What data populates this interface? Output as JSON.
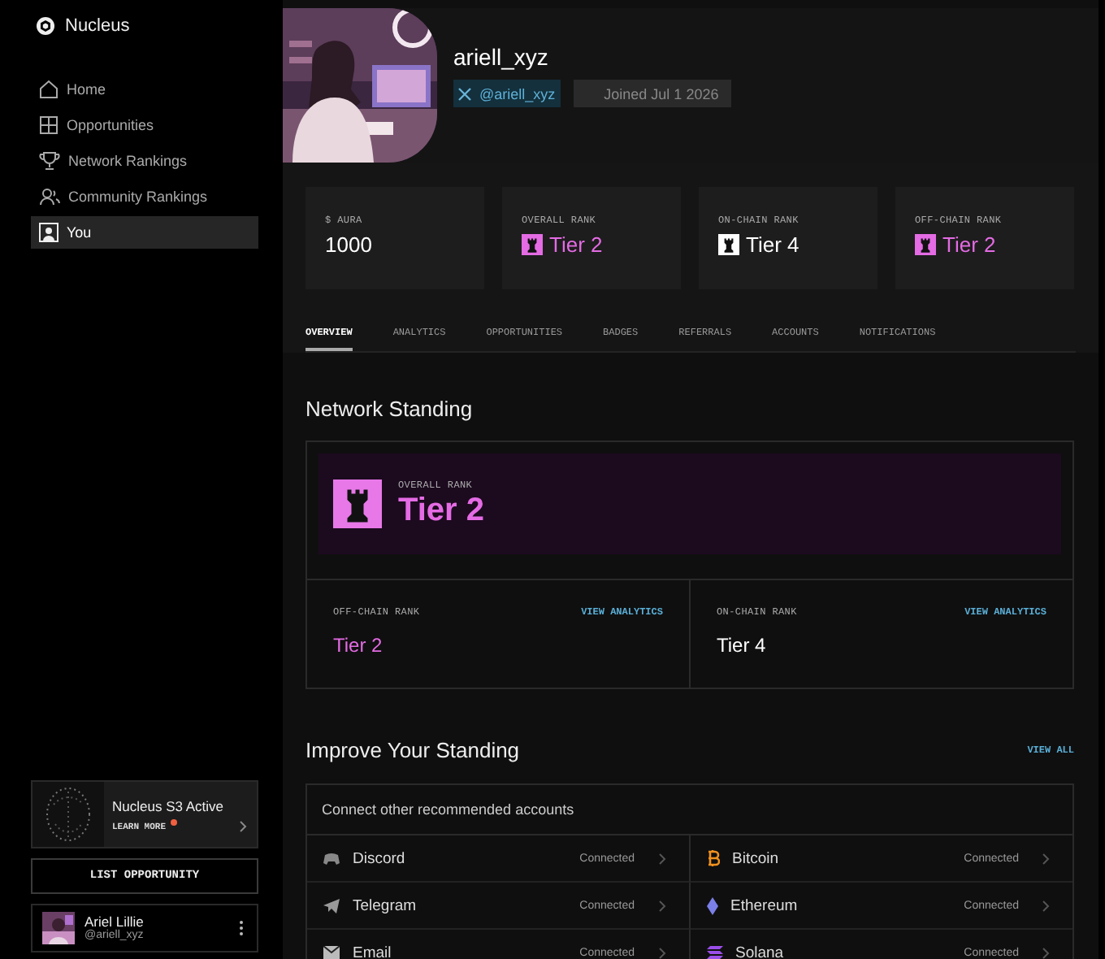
{
  "app": {
    "name": "Nucleus"
  },
  "nav": [
    {
      "label": "Home",
      "kind": "home",
      "selected": false
    },
    {
      "label": "Opportunities",
      "kind": "grid",
      "selected": false
    },
    {
      "label": "Network Rankings",
      "kind": "trophy",
      "selected": false
    },
    {
      "label": "Community Rankings",
      "kind": "people",
      "selected": false
    },
    {
      "label": "You",
      "kind": "user",
      "selected": true
    }
  ],
  "promo": {
    "title": "Nucleus S3 Active",
    "link": "LEARN MORE",
    "unread": true
  },
  "list_button": "LIST OPPORTUNITY",
  "user": {
    "name": "Ariel Lillie",
    "handle": "@ariell_xyz"
  },
  "profile": {
    "username": "ariell_xyz",
    "x_handle": "@ariell_xyz",
    "joined": "Joined Jul 1 2026"
  },
  "stats": [
    {
      "label": "$ AURA",
      "value": "1000",
      "kind": "plain"
    },
    {
      "label": "OVERALL RANK",
      "value": "Tier 2",
      "kind": "rank",
      "color": "#e46be4"
    },
    {
      "label": "ON-CHAIN RANK",
      "value": "Tier 4",
      "kind": "rank",
      "color": "#ffffff"
    },
    {
      "label": "OFF-CHAIN RANK",
      "value": "Tier 2",
      "kind": "rank",
      "color": "#e46be4"
    }
  ],
  "tabs": [
    {
      "label": "OVERVIEW",
      "selected": true
    },
    {
      "label": "ANALYTICS",
      "selected": false
    },
    {
      "label": "OPPORTUNITIES",
      "selected": false
    },
    {
      "label": "BADGES",
      "selected": false
    },
    {
      "label": "REFERRALS",
      "selected": false
    },
    {
      "label": "ACCOUNTS",
      "selected": false
    },
    {
      "label": "NOTIFICATIONS",
      "selected": false
    }
  ],
  "network_standing": {
    "title": "Network Standing",
    "overall": {
      "label": "OVERALL RANK",
      "value": "Tier 2"
    },
    "ranks": [
      {
        "label": "OFF-CHAIN RANK",
        "link": "VIEW ANALYTICS",
        "value": "Tier 2",
        "color": "#e46be4"
      },
      {
        "label": "ON-CHAIN RANK",
        "link": "VIEW ANALYTICS",
        "value": "Tier 4",
        "color": "#ffffff"
      }
    ]
  },
  "improve": {
    "title": "Improve Your Standing",
    "link": "VIEW ALL",
    "subtitle": "Connect other recommended accounts",
    "accounts": [
      {
        "name": "Discord",
        "kind": "discord",
        "status": "Connected"
      },
      {
        "name": "Bitcoin",
        "kind": "bitcoin",
        "status": "Connected"
      },
      {
        "name": "Telegram",
        "kind": "telegram",
        "status": "Connected"
      },
      {
        "name": "Ethereum",
        "kind": "ethereum",
        "status": "Connected"
      },
      {
        "name": "Email",
        "kind": "email",
        "status": "Connected"
      },
      {
        "name": "Solana",
        "kind": "solana",
        "status": "Connected"
      }
    ]
  }
}
